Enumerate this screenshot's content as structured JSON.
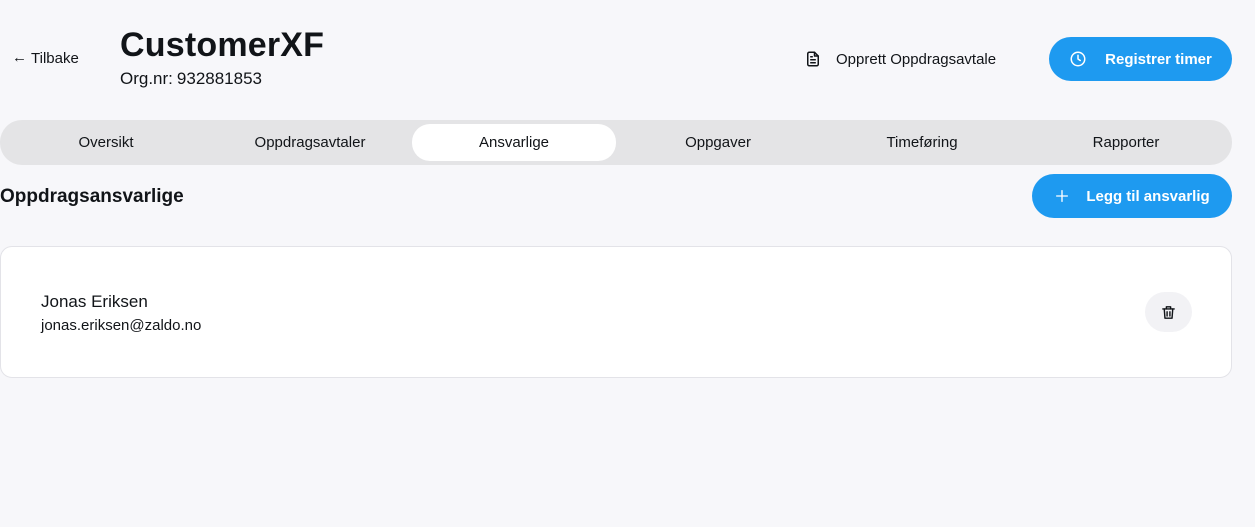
{
  "header": {
    "back_label": "Tilbake",
    "back_icon": "arrow-left-icon",
    "customer_name": "CustomerXF",
    "org_label": "Org.nr:",
    "org_number": "932881853",
    "create_agreement_label": "Opprett Oppdragsavtale",
    "create_agreement_icon": "document-icon",
    "register_hours_label": "Registrer timer",
    "register_hours_icon": "clock-icon"
  },
  "tabs": [
    {
      "label": "Oversikt",
      "active": false
    },
    {
      "label": "Oppdragsavtaler",
      "active": false
    },
    {
      "label": "Ansvarlige",
      "active": true
    },
    {
      "label": "Oppgaver",
      "active": false
    },
    {
      "label": "Timeføring",
      "active": false
    },
    {
      "label": "Rapporter",
      "active": false
    }
  ],
  "section": {
    "title": "Oppdragsansvarlige",
    "add_label": "Legg til ansvarlig",
    "add_icon": "plus-icon"
  },
  "responsibles": [
    {
      "name": "Jonas Eriksen",
      "email": "jonas.eriksen@zaldo.no",
      "delete_icon": "trash-icon"
    }
  ],
  "colors": {
    "accent": "#1e9af0",
    "background": "#f7f7fa",
    "tab_bar": "#e4e4e6",
    "card": "#ffffff"
  }
}
